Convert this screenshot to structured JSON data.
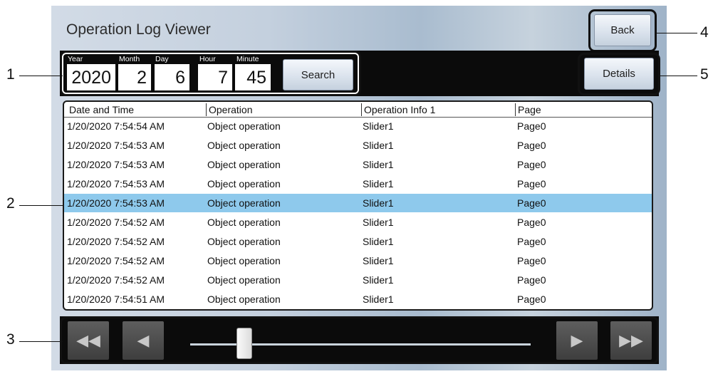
{
  "window": {
    "title": "Operation Log Viewer"
  },
  "buttons": {
    "back": "Back",
    "details": "Details",
    "search": "Search"
  },
  "datetime": {
    "labels": {
      "year": "Year",
      "month": "Month",
      "day": "Day",
      "hour": "Hour",
      "minute": "Minute"
    },
    "values": {
      "year": "2020",
      "month": "2",
      "day": "6",
      "hour": "7",
      "minute": "45"
    }
  },
  "table": {
    "columns": [
      "Date and Time",
      "Operation",
      "Operation Info 1",
      "Page"
    ],
    "rows": [
      [
        "1/20/2020 7:54:54 AM",
        "Object operation",
        "Slider1",
        "Page0"
      ],
      [
        "1/20/2020 7:54:53 AM",
        "Object operation",
        "Slider1",
        "Page0"
      ],
      [
        "1/20/2020 7:54:53 AM",
        "Object operation",
        "Slider1",
        "Page0"
      ],
      [
        "1/20/2020 7:54:53 AM",
        "Object operation",
        "Slider1",
        "Page0"
      ],
      [
        "1/20/2020 7:54:53 AM",
        "Object operation",
        "Slider1",
        "Page0"
      ],
      [
        "1/20/2020 7:54:52 AM",
        "Object operation",
        "Slider1",
        "Page0"
      ],
      [
        "1/20/2020 7:54:52 AM",
        "Object operation",
        "Slider1",
        "Page0"
      ],
      [
        "1/20/2020 7:54:52 AM",
        "Object operation",
        "Slider1",
        "Page0"
      ],
      [
        "1/20/2020 7:54:52 AM",
        "Object operation",
        "Slider1",
        "Page0"
      ],
      [
        "1/20/2020 7:54:51 AM",
        "Object operation",
        "Slider1",
        "Page0"
      ]
    ],
    "selected_row": 4
  },
  "paging": {
    "first_icon": "fast-rewind-icon",
    "prev_icon": "play-left-icon",
    "next_icon": "play-right-icon",
    "last_icon": "fast-forward-icon",
    "slider_position": 0.16
  },
  "callouts": [
    "1",
    "2",
    "3",
    "4",
    "5"
  ],
  "colors": {
    "selected_row": "#8ec9ec",
    "band": "#0b0b0b"
  }
}
